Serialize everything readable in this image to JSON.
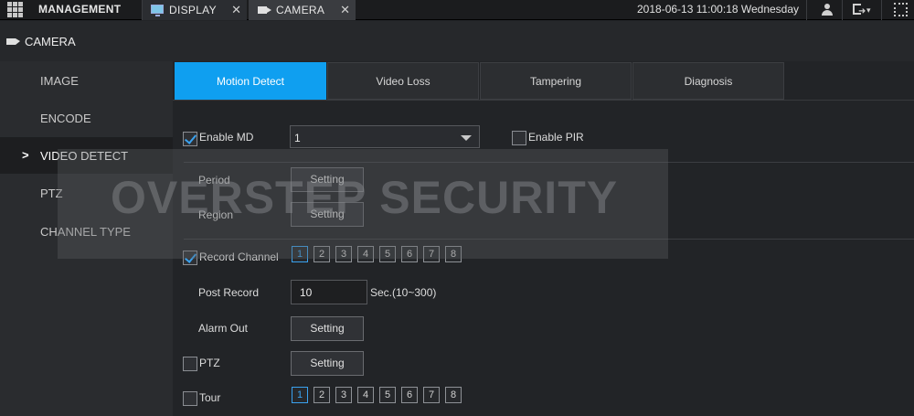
{
  "topbar": {
    "management_label": "MANAGEMENT",
    "tabs": [
      {
        "label": "DISPLAY",
        "icon": "monitor-icon",
        "close": "✕"
      },
      {
        "label": "CAMERA",
        "icon": "camera-icon",
        "close": "✕"
      }
    ],
    "datetime": "2018-06-13 11:00:18 Wednesday"
  },
  "page_title": "CAMERA",
  "sidebar": {
    "items": [
      {
        "label": "IMAGE"
      },
      {
        "label": "ENCODE"
      },
      {
        "label": "VIDEO DETECT",
        "active": true
      },
      {
        "label": "PTZ"
      },
      {
        "label": "CHANNEL TYPE"
      }
    ],
    "active_marker": ">"
  },
  "tabs": [
    {
      "label": "Motion Detect",
      "active": true
    },
    {
      "label": "Video Loss"
    },
    {
      "label": "Tampering"
    },
    {
      "label": "Diagnosis"
    }
  ],
  "form": {
    "enable_md": {
      "label": "Enable MD",
      "checked": true
    },
    "channel_select": {
      "value": "1"
    },
    "enable_pir": {
      "label": "Enable PIR",
      "checked": false
    },
    "period": {
      "label": "Period",
      "button": "Setting"
    },
    "region": {
      "label": "Region",
      "button": "Setting"
    },
    "record_channel": {
      "label": "Record Channel",
      "checked": true,
      "channels": [
        "1",
        "2",
        "3",
        "4",
        "5",
        "6",
        "7",
        "8"
      ],
      "selected": [
        "1"
      ]
    },
    "post_record": {
      "label": "Post Record",
      "value": "10",
      "unit": "Sec.(10~300)"
    },
    "alarm_out": {
      "label": "Alarm Out",
      "button": "Setting"
    },
    "ptz": {
      "label": "PTZ",
      "checked": false,
      "button": "Setting"
    },
    "tour": {
      "label": "Tour",
      "checked": false,
      "channels": [
        "1",
        "2",
        "3",
        "4",
        "5",
        "6",
        "7",
        "8"
      ],
      "selected": [
        "1"
      ]
    }
  },
  "watermark": "OVERSTEP SECURITY",
  "colors": {
    "accent": "#0f9ff0",
    "check": "#3aa2ef",
    "background": "#222427"
  }
}
